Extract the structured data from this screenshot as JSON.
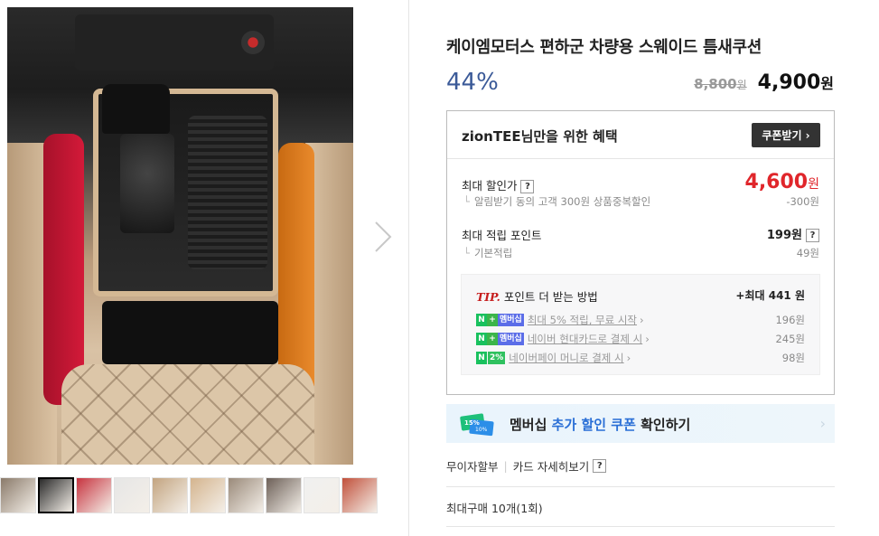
{
  "gallery": {
    "main_image_alt": "",
    "thumbnails": [
      {
        "name": "thumb-1",
        "color": "#8a7a6a"
      },
      {
        "name": "thumb-2",
        "color": "#2b2b2b"
      },
      {
        "name": "thumb-3",
        "color": "#c7333f"
      },
      {
        "name": "thumb-4",
        "color": "#e6e6e6"
      },
      {
        "name": "thumb-5",
        "color": "#c3a480"
      },
      {
        "name": "thumb-6",
        "color": "#d4b48e"
      },
      {
        "name": "thumb-7",
        "color": "#9a8a7a"
      },
      {
        "name": "thumb-8",
        "color": "#6d6058"
      },
      {
        "name": "thumb-9",
        "color": "#f0f0f0"
      },
      {
        "name": "thumb-10",
        "color": "#c1503b"
      }
    ]
  },
  "product": {
    "title": "케이엠모터스 편하군 차량용 스웨이드 틈새쿠션",
    "discount_rate": "44%",
    "original_price": "8,800",
    "original_unit": "원",
    "sale_price": "4,900",
    "sale_unit": "원"
  },
  "benefit": {
    "title": "zionTEE님만을 위한 혜택",
    "coupon_button": "쿠폰받기 ›",
    "max_discount_label": "최대 할인가",
    "max_discount_price": "4,600",
    "max_discount_unit": "원",
    "max_discount_sub_label": "알림받기 동의 고객 300원 상품중복할인",
    "max_discount_sub_value": "-300원",
    "max_point_label": "최대 적립 포인트",
    "max_point_value": "199원",
    "basic_point_label": "기본적립",
    "basic_point_value": "49원",
    "help_mark": "?",
    "tip": {
      "tip_word": "TIP.",
      "title": "포인트 더 받는 방법",
      "max_label": "+최대 441 원",
      "rows": [
        {
          "badge_n": "N",
          "badge_plus": "+",
          "badge_mem": "멤버십",
          "text": "최대 5% 적립, 무료 시작",
          "value": "196원"
        },
        {
          "badge_n": "N",
          "badge_plus": "+",
          "badge_mem": "멤버십",
          "text": "네이버 현대카드로 결제 시",
          "value": "245원"
        },
        {
          "badge_n": "N",
          "badge_pct": "2%",
          "text": "네이버페이 머니로 결제 시",
          "value": "98원"
        }
      ]
    }
  },
  "membership_banner": {
    "text_prefix": "멤버십",
    "text_highlight": "추가 할인 쿠폰",
    "text_suffix": "확인하기",
    "icon_pct_a": "15%",
    "icon_pct_b": "10%",
    "arrow": "›"
  },
  "links": {
    "installment": "무이자할부",
    "card_detail": "카드 자세히보기",
    "help_mark": "?"
  },
  "purchase_limit": "최대구매 10개(1회)",
  "colors": {
    "discount": "#3b5a98",
    "max_price": "#e0262b",
    "membership_highlight": "#2a6fd6",
    "naver_green": "#19c15e"
  }
}
